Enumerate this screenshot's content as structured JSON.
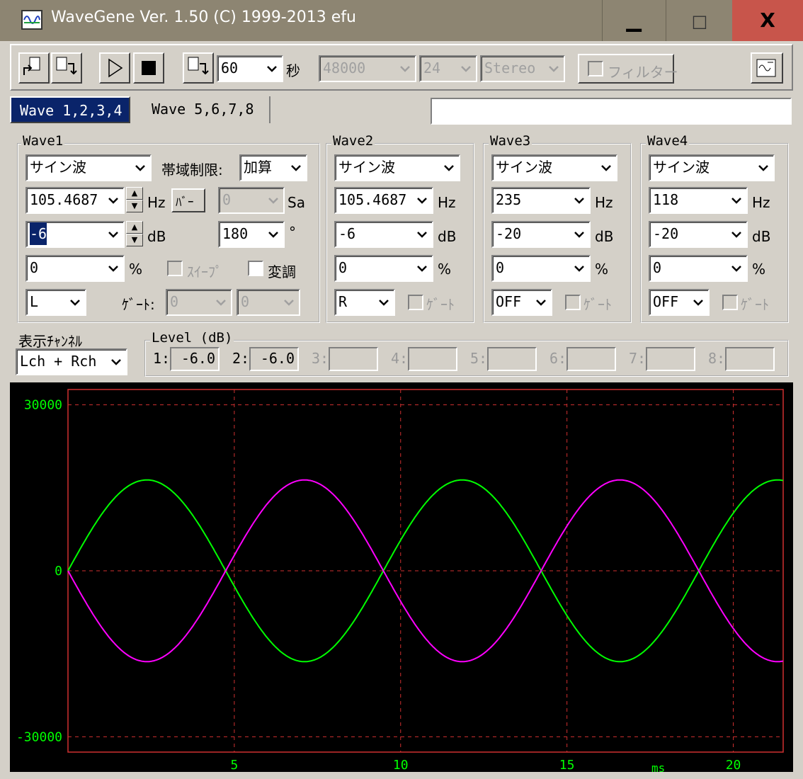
{
  "window": {
    "title": "WaveGene Ver. 1.50 (C) 1999-2013 efu",
    "icon": "wavegene-app-icon",
    "min_symbol": "▁",
    "max_symbol": "□",
    "close_symbol": "X"
  },
  "toolbar": {
    "duration": "60",
    "duration_unit": "秒",
    "sample_rate": "48000",
    "bit_depth": "24",
    "channels": "Stereo",
    "filter_label": "フィルター"
  },
  "tabs": [
    {
      "label": "Wave 1,2,3,4",
      "active": true
    },
    {
      "label": "Wave 5,6,7,8",
      "active": false
    }
  ],
  "tab_status_text": "",
  "wave1": {
    "title": "Wave1",
    "type": "サイン波",
    "band_label": "帯域制限:",
    "band_mode": "加算",
    "freq": "105.4687",
    "freq_unit": "Hz",
    "bar_label": "ﾊﾞｰ",
    "samples": "0",
    "samples_unit": "Sa",
    "level": "-6",
    "level_unit": "dB",
    "phase": "180",
    "phase_unit": "°",
    "offset": "0",
    "offset_unit": "%",
    "sweep_label": "ｽｲｰﾌﾟ",
    "mod_label": "変調",
    "channel": "L",
    "gate_label": "ｹﾞｰﾄ:",
    "gate_a": "0",
    "gate_b": "0"
  },
  "wave2": {
    "title": "Wave2",
    "type": "サイン波",
    "freq": "105.4687",
    "freq_unit": "Hz",
    "level": "-6",
    "level_unit": "dB",
    "offset": "0",
    "offset_unit": "%",
    "channel": "R",
    "gate_label": "ｹﾞｰﾄ"
  },
  "wave3": {
    "title": "Wave3",
    "type": "サイン波",
    "freq": "235",
    "freq_unit": "Hz",
    "level": "-20",
    "level_unit": "dB",
    "offset": "0",
    "offset_unit": "%",
    "channel": "OFF",
    "gate_label": "ｹﾞｰﾄ"
  },
  "wave4": {
    "title": "Wave4",
    "type": "サイン波",
    "freq": "118",
    "freq_unit": "Hz",
    "level": "-20",
    "level_unit": "dB",
    "offset": "0",
    "offset_unit": "%",
    "channel": "OFF",
    "gate_label": "ｹﾞｰﾄ"
  },
  "display": {
    "title": "表示ﾁｬﾝﾈﾙ",
    "channel": "Lch + Rch"
  },
  "levels": {
    "title": "Level (dB)",
    "items": [
      {
        "label": "1:",
        "value": "-6.0"
      },
      {
        "label": "2:",
        "value": "-6.0"
      },
      {
        "label": "3:",
        "value": ""
      },
      {
        "label": "4:",
        "value": ""
      },
      {
        "label": "5:",
        "value": ""
      },
      {
        "label": "6:",
        "value": ""
      },
      {
        "label": "7:",
        "value": ""
      },
      {
        "label": "8:",
        "value": ""
      }
    ]
  },
  "colors": {
    "lch": "#00ff00",
    "rch": "#ff00ff",
    "grid": "#d03030",
    "axis_text": "#00ff00"
  },
  "chart_data": {
    "type": "line",
    "xlabel": "ms",
    "x_ticks": [
      "5",
      "10",
      "15",
      "20"
    ],
    "y_ticks": [
      "30000",
      "0",
      "-30000"
    ],
    "xlim": [
      0,
      21.5
    ],
    "ylim": [
      -32768,
      32767
    ],
    "grid": true,
    "series": [
      {
        "channel": "Lch",
        "color": "#00ff00",
        "frequency_hz": 105.4687,
        "amplitude": 16422,
        "phase_deg": 0
      },
      {
        "channel": "Rch",
        "color": "#ff00ff",
        "frequency_hz": 105.4687,
        "amplitude": 16422,
        "phase_deg": 180
      }
    ]
  }
}
